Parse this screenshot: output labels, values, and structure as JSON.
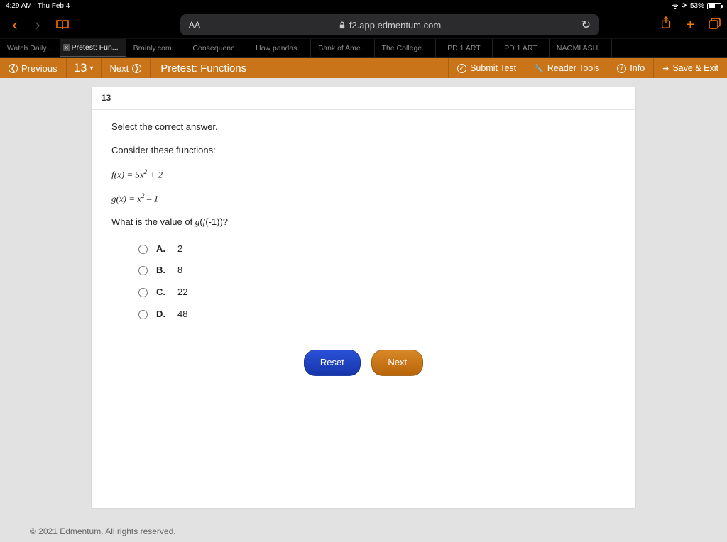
{
  "status": {
    "time": "4:29 AM",
    "date": "Thu Feb 4",
    "battery_pct": "53%"
  },
  "url": "f2.app.edmentum.com",
  "url_aa": "AA",
  "browser_tabs": [
    {
      "label": "Watch Daily...",
      "active": false
    },
    {
      "label": "Pretest: Fun...",
      "active": true
    },
    {
      "label": "Brainly.com...",
      "active": false
    },
    {
      "label": "Consequenc...",
      "active": false
    },
    {
      "label": "How pandas...",
      "active": false
    },
    {
      "label": "Bank of Ame...",
      "active": false
    },
    {
      "label": "The College...",
      "active": false
    },
    {
      "label": "PD 1 ART",
      "active": false
    },
    {
      "label": "PD 1 ART",
      "active": false
    },
    {
      "label": "NAOMI ASH...",
      "active": false
    }
  ],
  "toolbar": {
    "previous": "Previous",
    "qnum": "13",
    "next": "Next",
    "title": "Pretest: Functions",
    "submit": "Submit Test",
    "reader": "Reader Tools",
    "info": "Info",
    "save_exit": "Save & Exit"
  },
  "question": {
    "number": "13",
    "prompt": "Select the correct answer.",
    "intro": "Consider these functions:",
    "f_expr": "f(x) = 5x² + 2",
    "g_expr": "g(x) = x² – 1",
    "ask": "What is the value of g(f(-1))?",
    "choices": [
      {
        "key": "A.",
        "val": "2"
      },
      {
        "key": "B.",
        "val": "8"
      },
      {
        "key": "C.",
        "val": "22"
      },
      {
        "key": "D.",
        "val": "48"
      }
    ]
  },
  "buttons": {
    "reset": "Reset",
    "next": "Next"
  },
  "footer": "© 2021 Edmentum. All rights reserved."
}
